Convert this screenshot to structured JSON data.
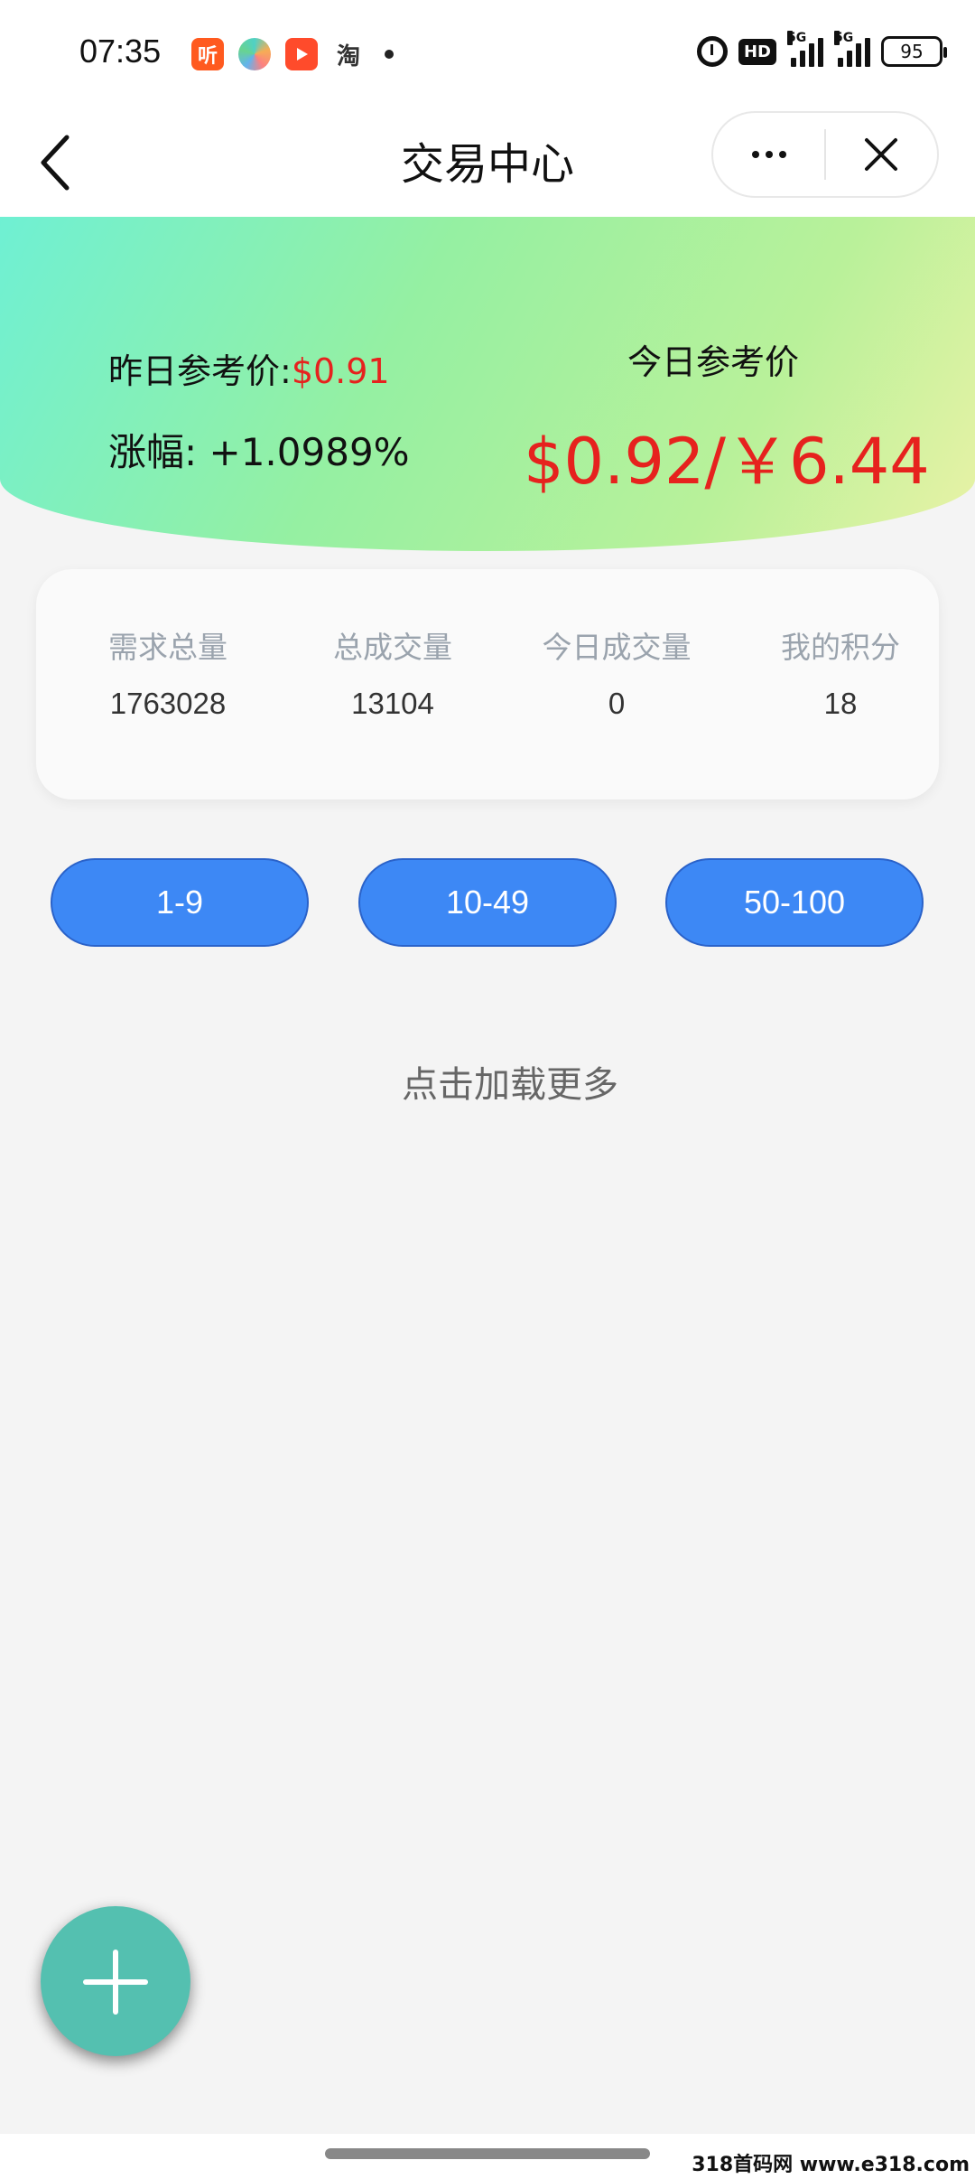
{
  "status_bar": {
    "time": "07:35",
    "apps": [
      "听",
      "淘"
    ],
    "hd_label": "HD",
    "signal_labels": [
      "5G",
      "5G"
    ],
    "battery": "95"
  },
  "nav": {
    "title": "交易中心"
  },
  "hero": {
    "yesterday_label": "昨日参考价:",
    "yesterday_value": "$0.91",
    "change_label": "涨幅:",
    "change_value": "+1.0989%",
    "today_label": "今日参考价",
    "today_price": "$0.92/￥6.44"
  },
  "stats": [
    {
      "label": "需求总量",
      "value": "1763028"
    },
    {
      "label": "总成交量",
      "value": "13104"
    },
    {
      "label": "今日成交量",
      "value": "0"
    },
    {
      "label": "我的积分",
      "value": "18"
    }
  ],
  "ranges": [
    "1-9",
    "10-49",
    "50-100"
  ],
  "load_more": "点击加载更多",
  "watermark": "318首码网 www.e318.com",
  "colors": {
    "price_red": "#e6221e",
    "button_blue": "#3d88f5",
    "fab_green": "#54c0b0"
  }
}
